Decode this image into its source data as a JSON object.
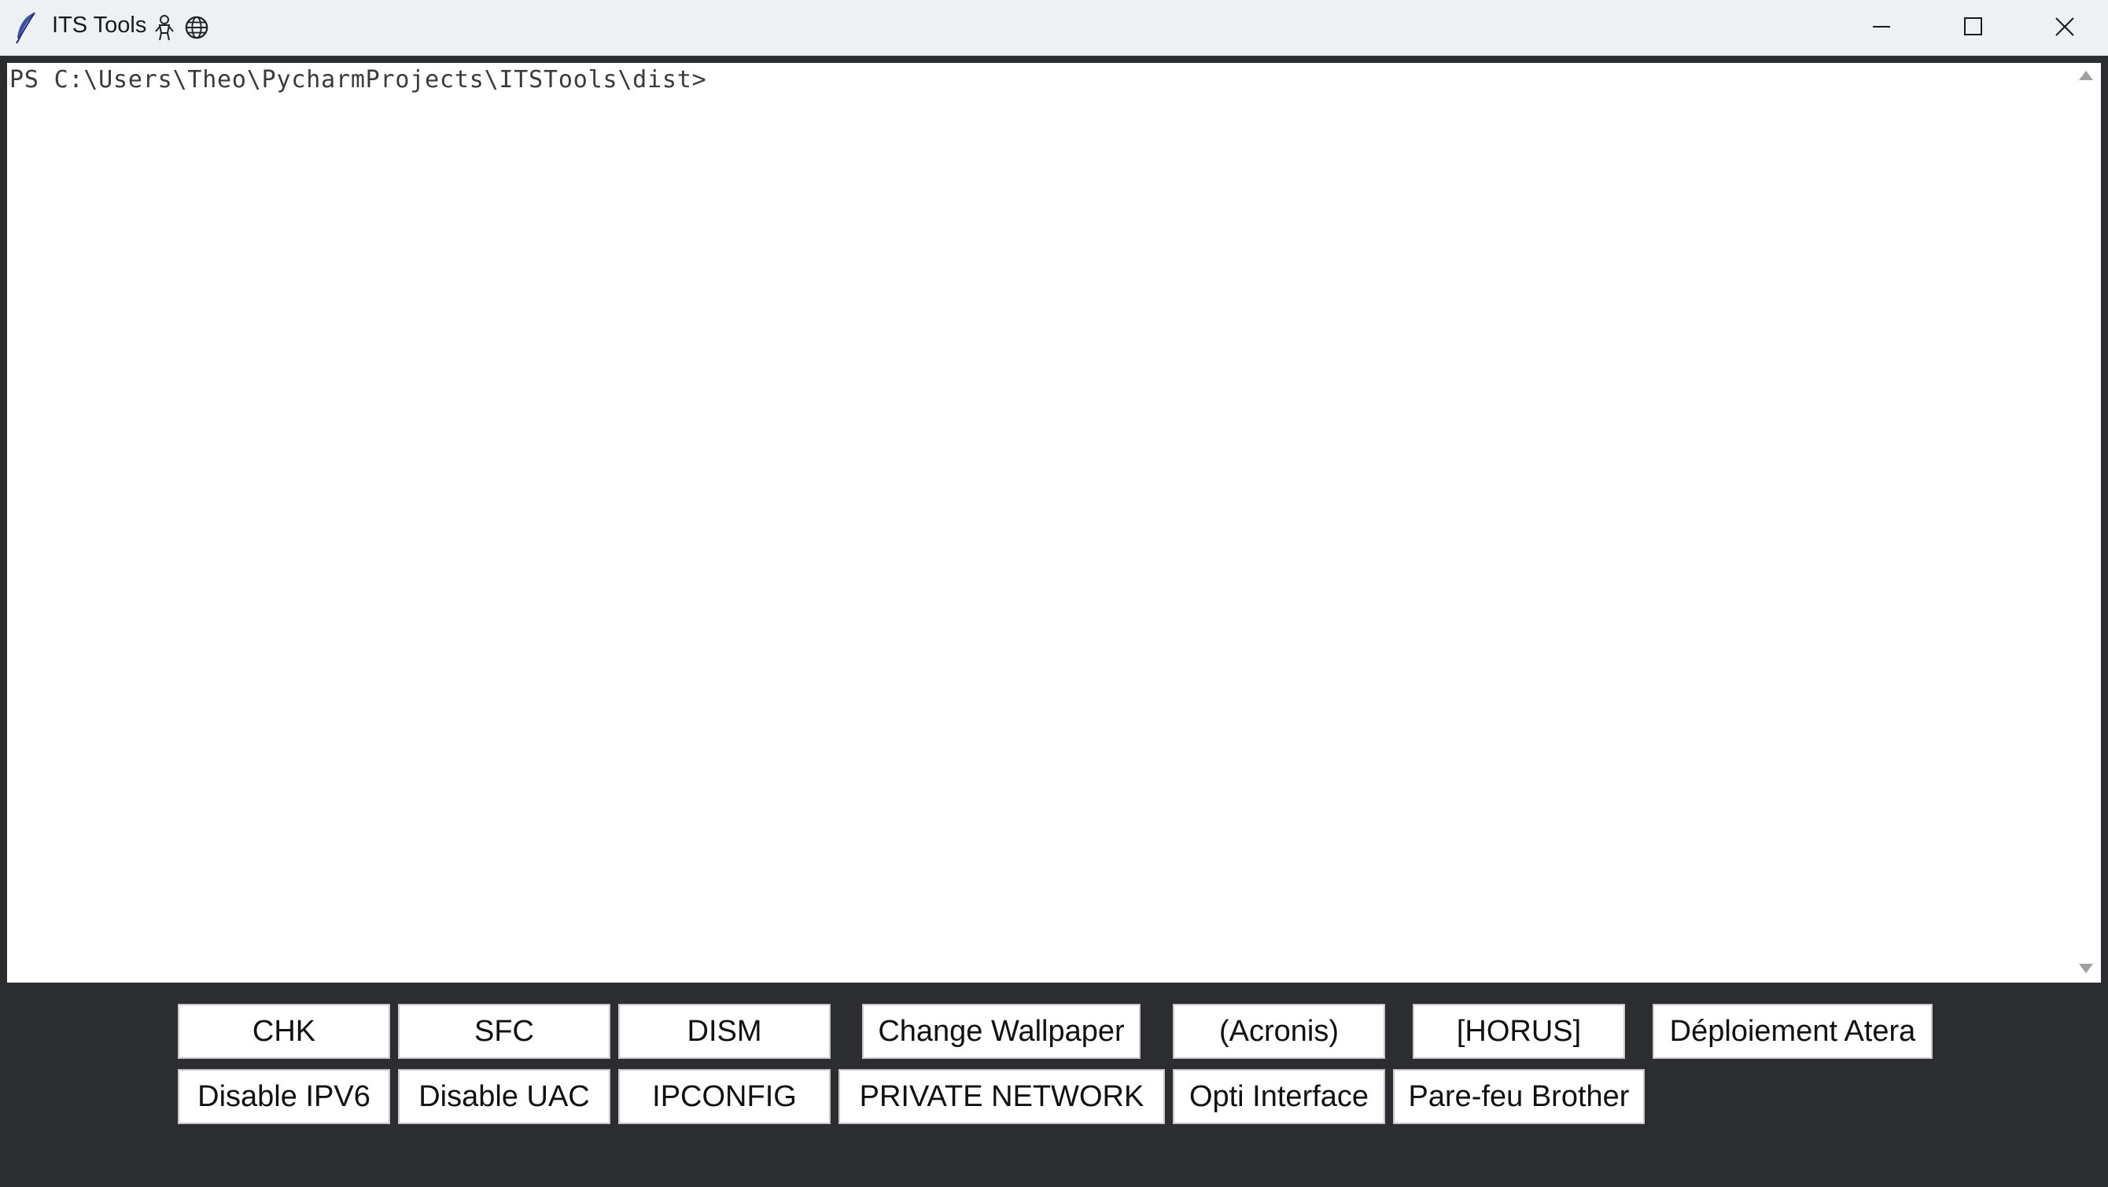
{
  "window": {
    "title": "ITS Tools",
    "title_icons": [
      "feather-icon",
      "person-emoji-icon",
      "globe-icon"
    ],
    "controls": [
      "minimize-icon",
      "maximize-icon",
      "close-icon"
    ]
  },
  "console": {
    "prompt": "PS C:\\Users\\Theo\\PycharmProjects\\ITSTools\\dist>"
  },
  "buttons": {
    "row1": [
      "CHK",
      "SFC",
      "DISM",
      "Change Wallpaper",
      "(Acronis)",
      "[HORUS]",
      "Déploiement Atera"
    ],
    "row2": [
      "Disable IPV6",
      "Disable UAC",
      "IPCONFIG",
      "PRIVATE NETWORK",
      "Opti Interface",
      "Pare-feu Brother"
    ]
  },
  "colors": {
    "titlebar": "#eef1f4",
    "background": "#2b2d31",
    "console_bg": "#ffffff",
    "button_bg": "#ffffff"
  }
}
